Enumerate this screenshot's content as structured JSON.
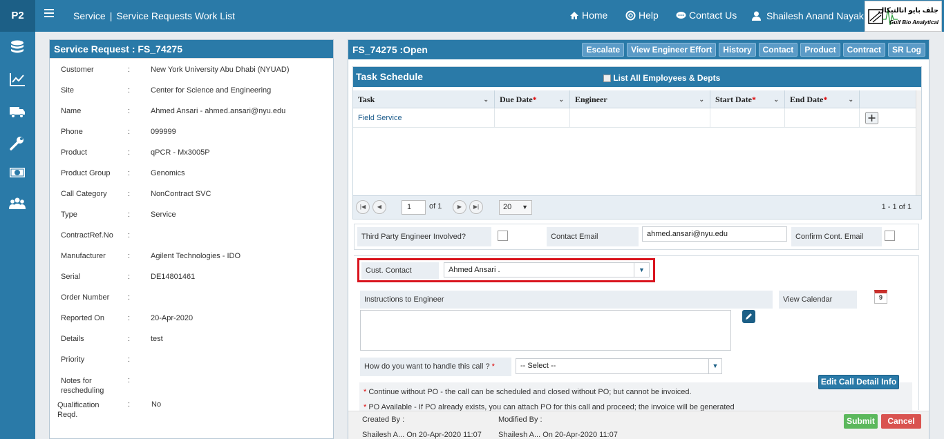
{
  "app": {
    "logo": "P2",
    "breadcrumb_section": "Service",
    "breadcrumb_page": "Service Requests Work List"
  },
  "topnav": {
    "home": "Home",
    "help": "Help",
    "contact": "Contact Us",
    "user": "Shailesh Anand Nayak"
  },
  "brand": {
    "arabic": "جلف بايو انالتيكال",
    "english": "Gulf Bio Analytical"
  },
  "left": {
    "title": "Service Request : FS_74275",
    "fields": [
      {
        "label": "Customer",
        "value": "New York University Abu Dhabi (NYUAD)"
      },
      {
        "label": "Site",
        "value": "Center for Science and Engineering"
      },
      {
        "label": "Name",
        "value": "Ahmed Ansari - ahmed.ansari@nyu.edu"
      },
      {
        "label": "Phone",
        "value": "099999"
      },
      {
        "label": "Product",
        "value": "qPCR - Mx3005P"
      },
      {
        "label": "Product Group",
        "value": "Genomics"
      },
      {
        "label": "Call Category",
        "value": "NonContract SVC"
      },
      {
        "label": "Type",
        "value": "Service"
      },
      {
        "label": "ContractRef.No",
        "value": ""
      },
      {
        "label": "Manufacturer",
        "value": "Agilent Technologies - IDO"
      },
      {
        "label": "Serial",
        "value": "DE14801461"
      },
      {
        "label": "Order Number",
        "value": ""
      },
      {
        "label": "Reported On",
        "value": "20-Apr-2020"
      },
      {
        "label": "Details",
        "value": "test"
      },
      {
        "label": "Priority",
        "value": ""
      },
      {
        "label": "Notes for rescheduling",
        "value": ""
      },
      {
        "label": "Qualification Reqd.",
        "value": "No"
      }
    ],
    "colon": ":"
  },
  "right": {
    "title": "FS_74275 :Open",
    "buttons": [
      "Escalate",
      "View Engineer Effort",
      "History",
      "Contact",
      "Product",
      "Contract",
      "SR Log"
    ],
    "task_schedule": {
      "title": "Task Schedule",
      "list_all_label": "List All Employees & Depts",
      "columns": [
        "Task",
        "Due Date",
        "Engineer",
        "Start Date",
        "End Date"
      ],
      "required_mark": "*",
      "rows": [
        {
          "task": "Field Service",
          "due": "",
          "engineer": "",
          "start": "",
          "end": ""
        }
      ],
      "pager": {
        "page": "1",
        "of": "of 1",
        "page_size": "20",
        "summary": "1 - 1 of 1"
      }
    },
    "form": {
      "third_party_label": "Third Party Engineer Involved?",
      "contact_email_label": "Contact Email",
      "contact_email_value": "ahmed.ansari@nyu.edu",
      "confirm_email_label": "Confirm Cont. Email",
      "cust_contact_label": "Cust. Contact",
      "cust_contact_value": "Ahmed Ansari .",
      "instructions_label": "Instructions to Engineer",
      "view_calendar_label": "View Calendar",
      "calendar_day": "9",
      "handle_label": "How do you want to handle this call ?",
      "handle_value": "-- Select --",
      "edit_call_btn": "Edit Call Detail Info",
      "note1": "Continue without PO - the call can be scheduled and closed without PO; but cannot be invoiced.",
      "note2": "PO Available - If PO already exists, you can attach PO for this call and proceed; the invoice will be generated"
    },
    "footer": {
      "created_by_label": "Created By :",
      "modified_by_label": "Modified By :",
      "created_value": "Shailesh A... On 20-Apr-2020 11:07",
      "modified_value": "Shailesh A... On 20-Apr-2020 11:07",
      "submit": "Submit",
      "cancel": "Cancel"
    }
  },
  "colors": {
    "primary": "#2a7aa8",
    "dark": "#1c5f86",
    "highlight": "#d9141e",
    "submit": "#5cb85c",
    "cancel": "#d9534f"
  }
}
